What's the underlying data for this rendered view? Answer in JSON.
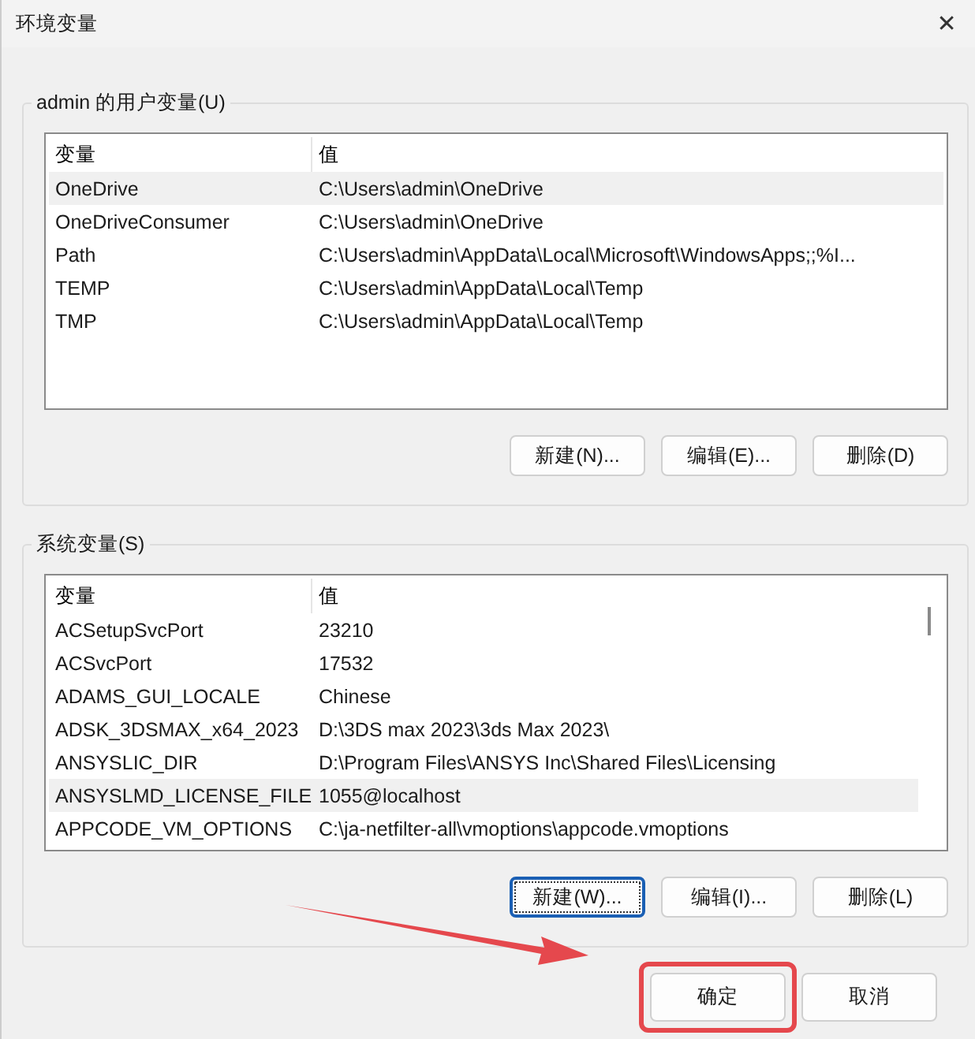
{
  "window": {
    "title": "环境变量",
    "close": "✕"
  },
  "groups": [
    {
      "label": "admin 的用户变量(U)",
      "columns": [
        "变量",
        "值"
      ],
      "scrollbar": false,
      "rows": [
        {
          "name": "OneDrive",
          "value": "C:\\Users\\admin\\OneDrive",
          "selected": true
        },
        {
          "name": "OneDriveConsumer",
          "value": "C:\\Users\\admin\\OneDrive",
          "selected": false
        },
        {
          "name": "Path",
          "value": "C:\\Users\\admin\\AppData\\Local\\Microsoft\\WindowsApps;;%I...",
          "selected": false
        },
        {
          "name": "TEMP",
          "value": "C:\\Users\\admin\\AppData\\Local\\Temp",
          "selected": false
        },
        {
          "name": "TMP",
          "value": "C:\\Users\\admin\\AppData\\Local\\Temp",
          "selected": false
        }
      ],
      "buttons": [
        {
          "label": "新建(N)...",
          "focused": false
        },
        {
          "label": "编辑(E)...",
          "focused": false
        },
        {
          "label": "删除(D)",
          "focused": false
        }
      ]
    },
    {
      "label": "系统变量(S)",
      "columns": [
        "变量",
        "值"
      ],
      "scrollbar": true,
      "rows": [
        {
          "name": "ACSetupSvcPort",
          "value": "23210",
          "selected": false
        },
        {
          "name": "ACSvcPort",
          "value": "17532",
          "selected": false
        },
        {
          "name": "ADAMS_GUI_LOCALE",
          "value": "Chinese",
          "selected": false
        },
        {
          "name": "ADSK_3DSMAX_x64_2023",
          "value": "D:\\3DS max 2023\\3ds Max 2023\\",
          "selected": false
        },
        {
          "name": "ANSYSLIC_DIR",
          "value": "D:\\Program Files\\ANSYS Inc\\Shared Files\\Licensing",
          "selected": false
        },
        {
          "name": "ANSYSLMD_LICENSE_FILE",
          "value": "1055@localhost",
          "selected": true
        },
        {
          "name": "APPCODE_VM_OPTIONS",
          "value": "C:\\ja-netfilter-all\\vmoptions\\appcode.vmoptions",
          "selected": false
        }
      ],
      "buttons": [
        {
          "label": "新建(W)...",
          "focused": true
        },
        {
          "label": "编辑(I)...",
          "focused": false
        },
        {
          "label": "删除(L)",
          "focused": false
        }
      ]
    }
  ],
  "footer_buttons": [
    {
      "label": "确定",
      "focused": false,
      "highlighted": true
    },
    {
      "label": "取消",
      "focused": false,
      "highlighted": false
    }
  ]
}
